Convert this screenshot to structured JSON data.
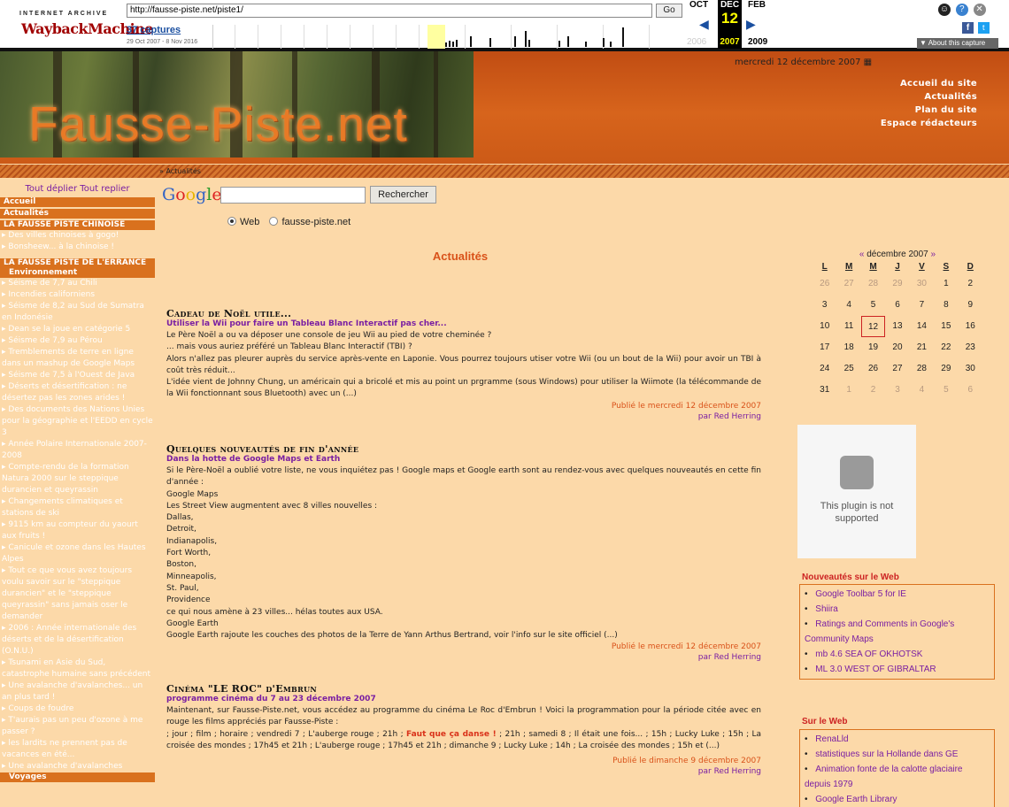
{
  "wayback": {
    "brand_top": "INTERNET ARCHIVE",
    "brand_logo": "WaybackMachine",
    "url": "http://fausse-piste.net/piste1/",
    "go_label": "Go",
    "captures": "37 captures",
    "capture_range": "29 Oct 2007 - 8 Nov 2016",
    "prev_month": "OCT",
    "current_month": "DEC",
    "current_day": "12",
    "next_month": "FEB",
    "prev_year": "2006",
    "current_year": "2007",
    "next_year": "2009",
    "about_label": "▼ About this capture"
  },
  "site": {
    "logo_text": "Fausse-Piste.net",
    "date": "mercredi 12 décembre 2007",
    "nav": [
      "Accueil du site",
      "Actualités",
      "Plan du site",
      "Espace rédacteurs"
    ],
    "breadcrumb": "» Actualités"
  },
  "left": {
    "expand_all": "Tout déplier Tout replier",
    "accueil": "Accueil",
    "actualites": "Actualités",
    "section1": "LA FAUSSE PISTE CHINOISE",
    "section1_items": [
      "Des villes chinoises à gogo!",
      "Bonsheew... à la chinoise !"
    ],
    "section2": "LA FAUSSE PISTE DE L'ERRANCE",
    "sub_env": "Environnement",
    "env_items": [
      "Séisme de 7,7 au Chili",
      "Incendies californiens",
      "Séisme de 8,2 au Sud de Sumatra en Indonésie",
      "Dean se la joue en catégorie 5",
      "Séisme de 7,9 au Pérou",
      "Tremblements de terre en ligne dans un mashup de Google Maps",
      "Séisme de 7,5 à l'Ouest de Java",
      "Déserts et désertification : ne désertez pas les zones arides !",
      "Des documents des Nations Unies pour la géographie et l'EEDD en cycle 3",
      "Année Polaire Internationale 2007-2008",
      "Compte-rendu de la formation Natura 2000 sur le steppique durancien et queyrassin",
      "Changements climatiques et stations de ski",
      "9115 km au compteur du yaourt aux fruits !",
      "Canicule et ozone dans les Hautes Alpes",
      "Tout ce que vous avez toujours voulu savoir sur le \"steppique durancien\" et le \"steppique queyrassin\" sans jamais oser le demander",
      "2006 : Année internationale des déserts et de la désertification (O.N.U.)",
      "Tsunami en Asie du Sud, catastrophe humaine sans précédent",
      "Une avalanche d'avalanches... un an plus tard !",
      "Coups de foudre",
      "T'aurais pas un peu d'ozone à me passer ?",
      "les lardits ne prennent pas de vacances en été...",
      "Une avalanche d'avalanches"
    ],
    "sub_voyages": "Voyages"
  },
  "search": {
    "button": "Rechercher",
    "opt_web": "Web",
    "opt_site": "fausse-piste.net"
  },
  "main": {
    "title": "Actualités",
    "articles": [
      {
        "title": "Cadeau de Noël utile...",
        "subtitle": "Utiliser la Wii pour faire un Tableau Blanc Interactif pas cher...",
        "body": "Le Père Noël a ou va déposer une console de jeu Wii au pied de votre cheminée ?\n... mais vous auriez préféré un Tableau Blanc Interactif (TBI) ?\nAlors n'allez pas pleurer auprès du service après-vente en Laponie. Vous pourrez toujours utiser votre Wii (ou un bout de la Wii) pour avoir un TBI à coût très réduit...\nL'idée vient de Johnny Chung, un américain qui a bricolé et mis au point un prgramme (sous Windows) pour utiliser la Wiimote (la télécommande de la Wii fonctionnant sous Bluetooth) avec un (...)",
        "date": "Publié le mercredi 12 décembre 2007",
        "author": "par Red Herring"
      },
      {
        "title": "Quelques nouveautés de fin d'année",
        "subtitle": "Dans la hotte de Google Maps et Earth",
        "body": "Si le Père-Noël a oublié votre liste, ne vous inquiétez pas ! Google maps et Google earth sont au rendez-vous avec quelques nouveautés en cette fin d'année :\nGoogle Maps\nLes Street View augmentent avec 8 villes nouvelles :\nDallas,\nDetroit,\nIndianapolis,\nFort Worth,\nBoston,\nMinneapolis,\nSt. Paul,\nProvidence\nce qui nous amène à 23 villes... hélas toutes aux USA.\nGoogle Earth\nGoogle Earth rajoute les couches des photos de la Terre de Yann Arthus Bertrand, voir l'info sur le site officiel (...)",
        "date": "Publié le mercredi 12 décembre 2007",
        "author": "par Red Herring"
      },
      {
        "title": "Cinéma \"LE ROC\" d'Embrun",
        "subtitle": "programme cinéma du 7 au 23 décembre 2007",
        "body1": "Maintenant, sur Fausse-Piste.net, vous accédez au programme du cinéma Le Roc d'Embrun ! Voici la programmation pour la période citée avec en rouge les films appréciés par Fausse-Piste :",
        "body2a": "; jour ; film ; horaire ; vendredi 7 ; L'auberge rouge ; 21h ;",
        "body2hl": "Faut que ça danse !",
        "body2b": "; 21h ; samedi 8 ; Il était une fois... ; 15h ; Lucky Luke ; 15h ; La croisée des mondes ; 17h45 et 21h ; L'auberge rouge ; 17h45 et 21h ; dimanche 9 ; Lucky Luke ; 14h ; La croisée des mondes ; 15h et (...)",
        "date": "Publié le dimanche 9 décembre 2007",
        "author": "par Red Herring"
      }
    ]
  },
  "calendar": {
    "prev": "«",
    "month": "décembre 2007",
    "next": "»",
    "days": [
      "L",
      "M",
      "M",
      "J",
      "V",
      "S",
      "D"
    ],
    "cells": [
      "26",
      "27",
      "28",
      "29",
      "30",
      "1",
      "2",
      "3",
      "4",
      "5",
      "6",
      "7",
      "8",
      "9",
      "10",
      "11",
      "12",
      "13",
      "14",
      "15",
      "16",
      "17",
      "18",
      "19",
      "20",
      "21",
      "22",
      "23",
      "24",
      "25",
      "26",
      "27",
      "28",
      "29",
      "30",
      "31",
      "1",
      "2",
      "3",
      "4",
      "5",
      "6"
    ],
    "today": "12"
  },
  "plugin": {
    "text": "This plugin is not supported"
  },
  "news_web": {
    "title": "Nouveautés sur le Web",
    "items": [
      "Google Toolbar 5 for IE",
      "Shiira",
      "Ratings and Comments in Google's Community Maps",
      "mb 4.6 SEA OF OKHOTSK",
      "ML 3.0 WEST OF GIBRALTAR"
    ]
  },
  "on_web": {
    "title": "Sur le Web",
    "items": [
      "RenaLld",
      "statistiques sur la Hollande dans GE",
      "Animation fonte de la calotte glaciaire depuis 1979",
      "Google Earth Library"
    ]
  },
  "colors": {
    "accent": "#d9711e",
    "link": "#7a1fa2",
    "highlight": "#d9321a"
  }
}
